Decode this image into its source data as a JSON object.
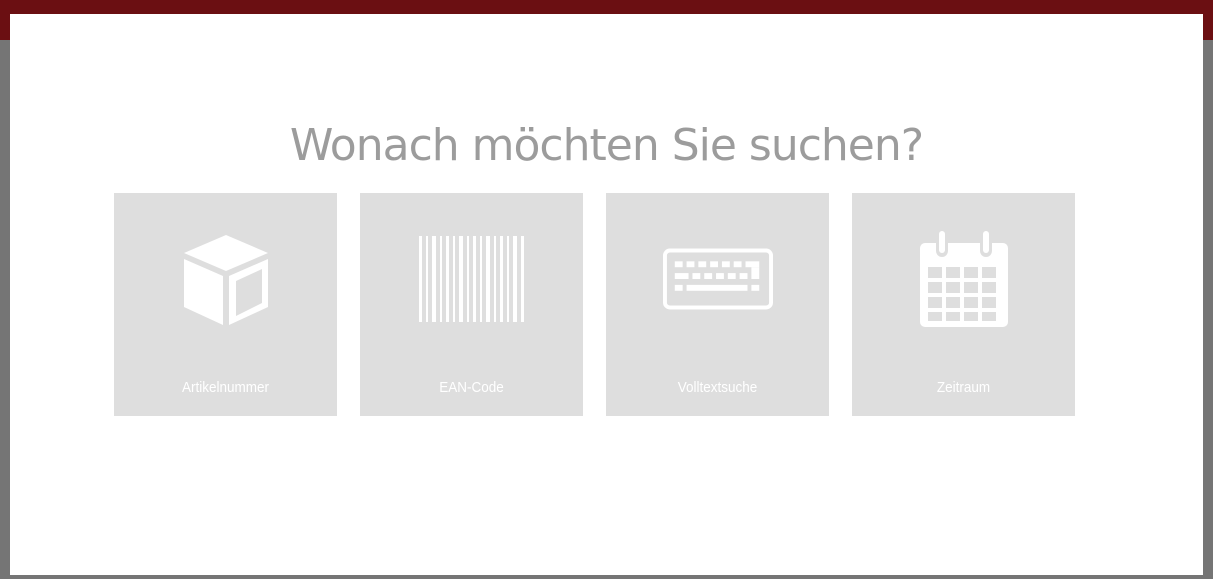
{
  "modal": {
    "title": "Wonach möchten Sie suchen?"
  },
  "options": [
    {
      "label": "Artikelnummer",
      "icon": "cube-icon"
    },
    {
      "label": "EAN-Code",
      "icon": "barcode-icon"
    },
    {
      "label": "Volltextsuche",
      "icon": "keyboard-icon"
    },
    {
      "label": "Zeitraum",
      "icon": "calendar-icon"
    }
  ],
  "colors": {
    "topbar": "#7a1215",
    "backdrop": "#757575",
    "tile": "#dedede",
    "title": "#9c9c9c",
    "icon": "#ffffff"
  }
}
